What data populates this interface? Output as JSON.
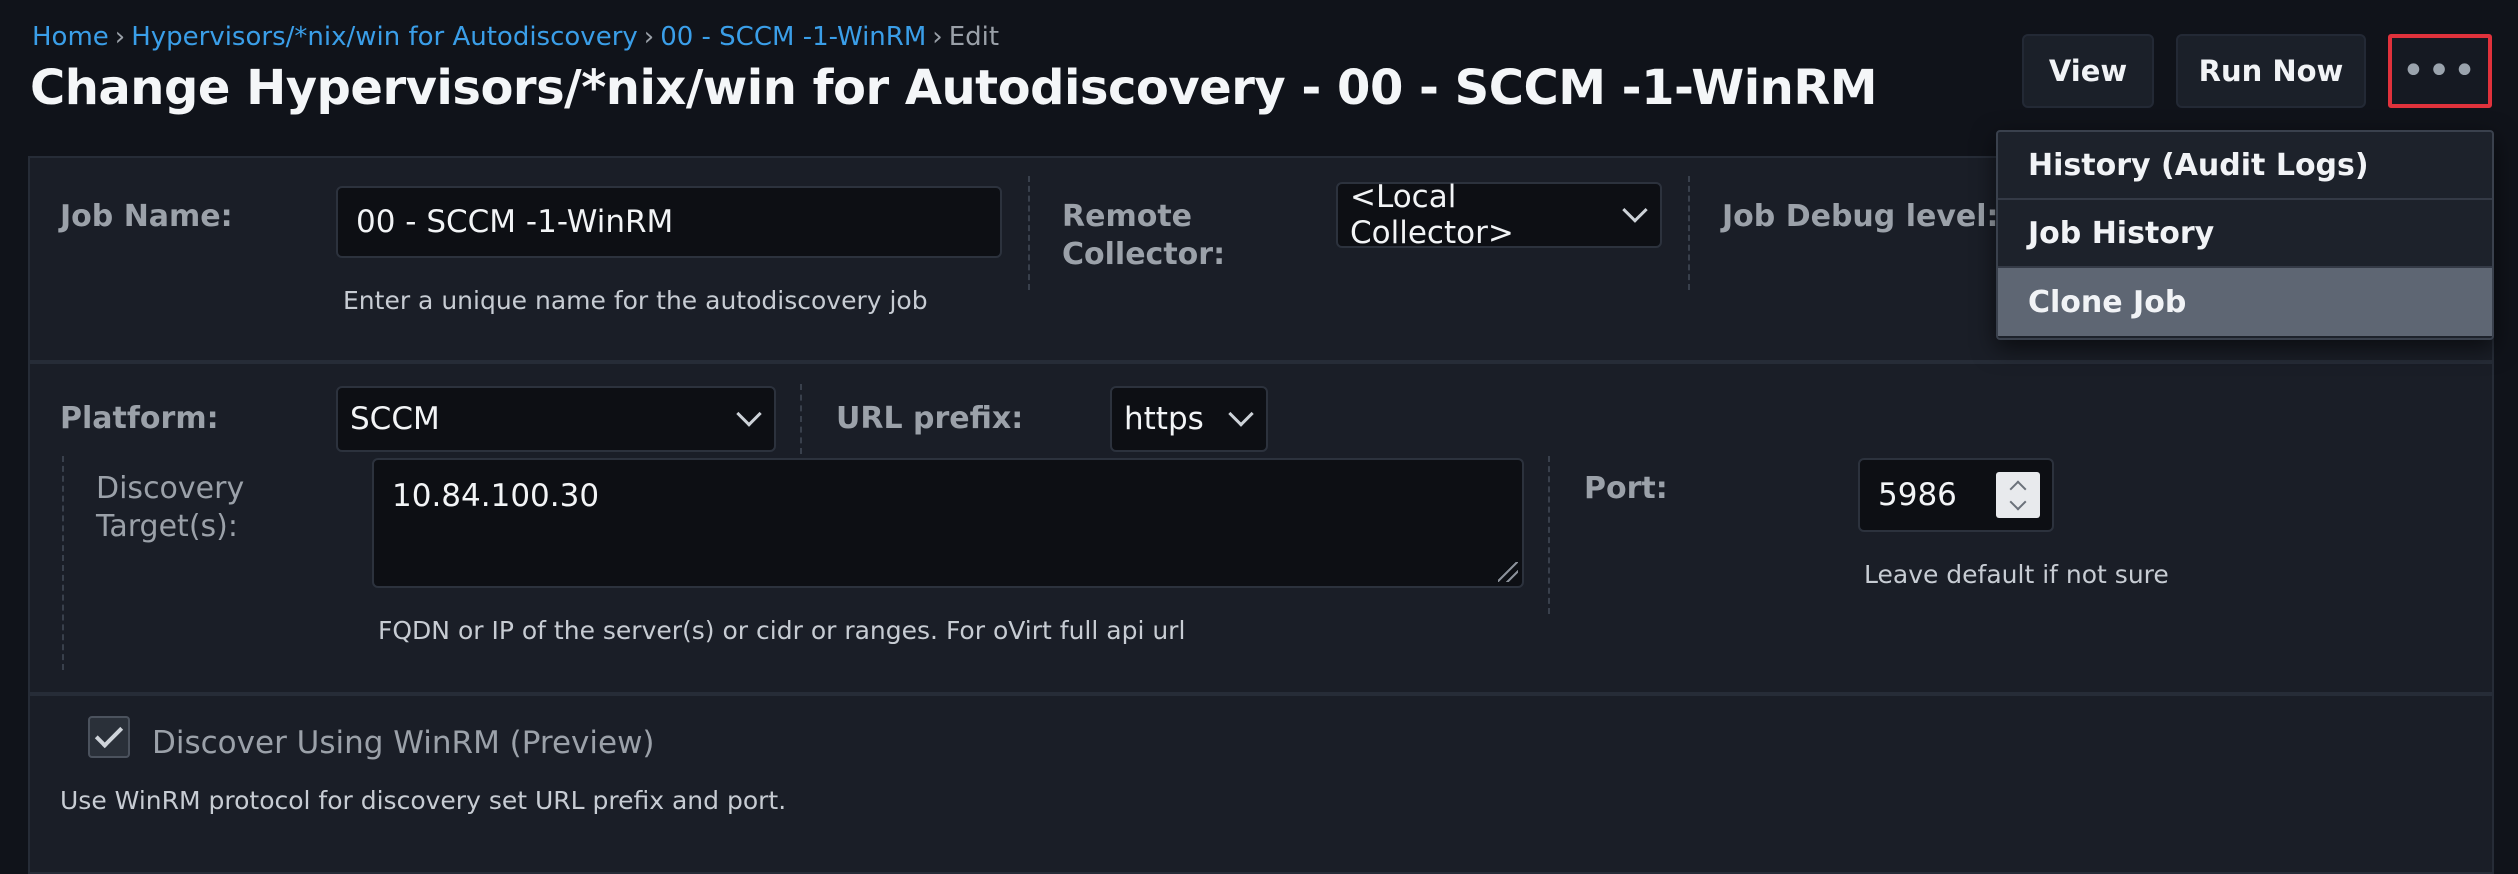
{
  "breadcrumb": {
    "home": "Home",
    "sep": "›",
    "section": "Hypervisors/*nix/win for Autodiscovery",
    "job": "00 - SCCM -1-WinRM",
    "current": "Edit"
  },
  "page_title": "Change Hypervisors/*nix/win for Autodiscovery - 00 - SCCM -1-WinRM",
  "header_buttons": {
    "view": "View",
    "run_now": "Run Now",
    "more": "•••"
  },
  "menu": {
    "items": [
      "History (Audit Logs)",
      "Job History",
      "Clone Job"
    ]
  },
  "job": {
    "name_label": "Job Name:",
    "name_value": "00 - SCCM -1-WinRM",
    "name_help": "Enter a unique name for the autodiscovery job",
    "remote_collector_label_1": "Remote",
    "remote_collector_label_2": "Collector:",
    "remote_collector_value": "<Local Collector>",
    "debug_label": "Job Debug level:"
  },
  "platform": {
    "label": "Platform:",
    "value": "SCCM",
    "url_prefix_label": "URL prefix:",
    "url_prefix_value": "https"
  },
  "discovery": {
    "label_1": "Discovery",
    "label_2": "Target(s):",
    "value": "10.84.100.30",
    "help": "FQDN or IP of the server(s) or cidr or ranges. For oVirt full api url",
    "port_label": "Port:",
    "port_value": "5986",
    "port_help": "Leave default if not sure"
  },
  "winrm": {
    "checked": true,
    "label": "Discover Using WinRM (Preview)",
    "help": "Use WinRM protocol for discovery set URL prefix and port."
  },
  "colors": {
    "background": "#10131a",
    "link": "#3a9ee8",
    "highlight_border": "#e0323c",
    "menu_highlight": "#5e6673"
  }
}
